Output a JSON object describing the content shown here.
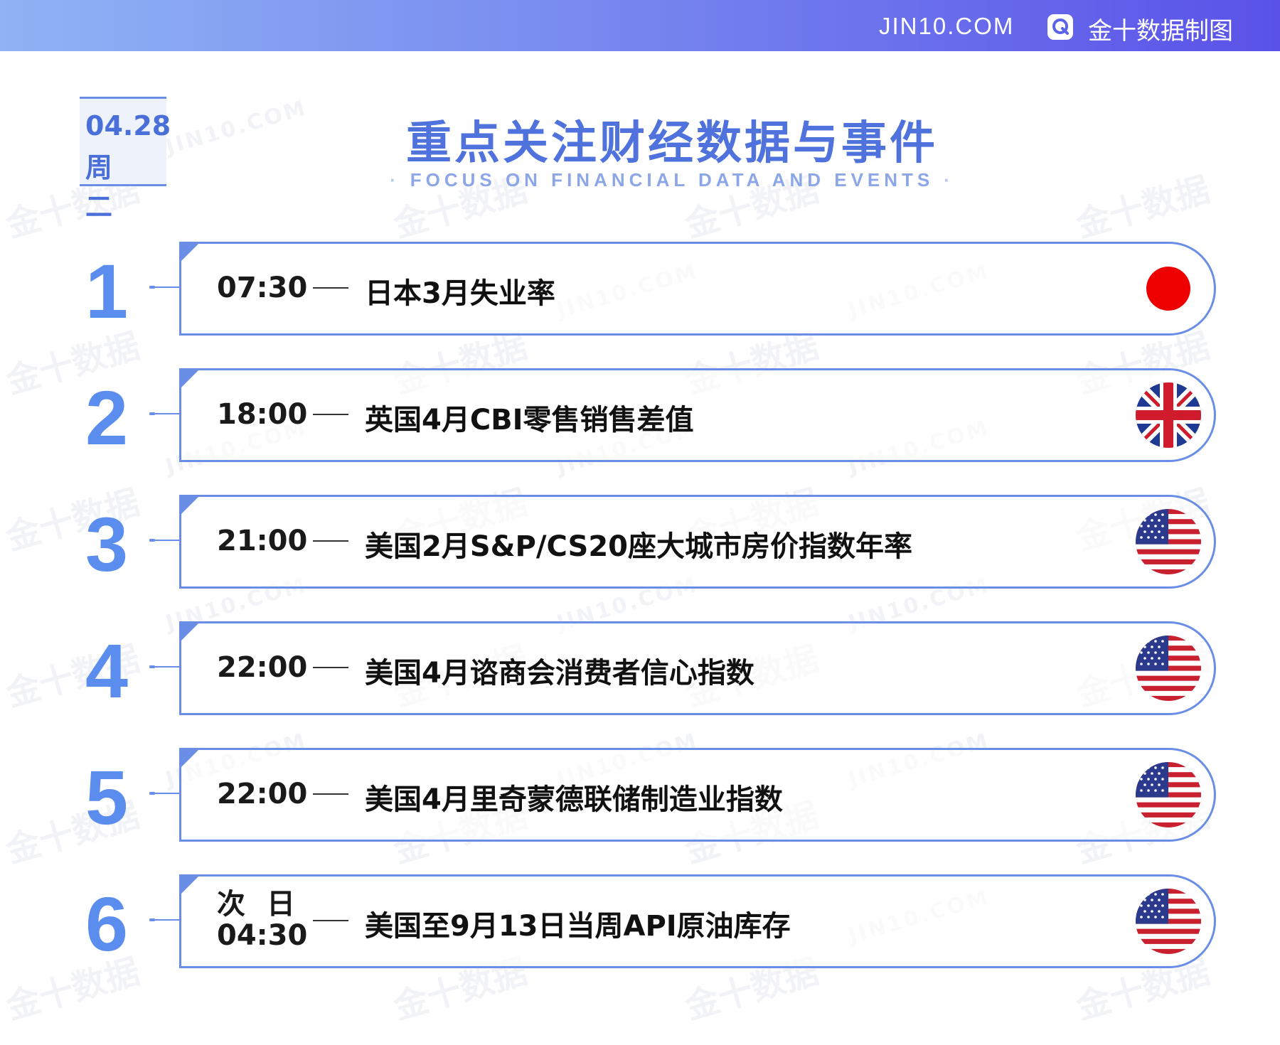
{
  "header": {
    "site": "JIN10.COM",
    "brand": "金十数据制图",
    "brand_icon": "q-logo-icon"
  },
  "watermark": {
    "cn": "金十数据",
    "en": "JIN10.COM"
  },
  "date": {
    "day": "04.28",
    "weekday": "周二"
  },
  "title": "重点关注财经数据与事件",
  "subtitle": "FOCUS ON FINANCIAL DATA AND EVENTS",
  "colors": {
    "accent": "#5b8def",
    "border": "#6a8ee6",
    "title": "#4f72dd"
  },
  "events": [
    {
      "num": "1",
      "time": "07:30",
      "title": "日本3月失业率",
      "flag": "japan-flag-icon"
    },
    {
      "num": "2",
      "time": "18:00",
      "title": "英国4月CBI零售销售差值",
      "flag": "uk-flag-icon"
    },
    {
      "num": "3",
      "time": "21:00",
      "title": "美国2月S&P/CS20座大城市房价指数年率",
      "flag": "us-flag-icon"
    },
    {
      "num": "4",
      "time": "22:00",
      "title": "美国4月谘商会消费者信心指数",
      "flag": "us-flag-icon"
    },
    {
      "num": "5",
      "time": "22:00",
      "title": "美国4月里奇蒙德联储制造业指数",
      "flag": "us-flag-icon"
    },
    {
      "num": "6",
      "time_line1": "次日",
      "time_line2": "04:30",
      "title": "美国至9月13日当周API原油库存",
      "flag": "us-flag-icon"
    }
  ]
}
